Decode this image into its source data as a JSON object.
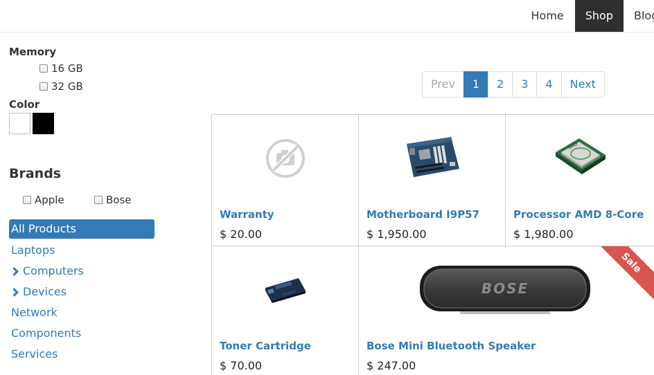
{
  "nav": {
    "items": [
      {
        "label": "Home",
        "active": false
      },
      {
        "label": "Shop",
        "active": true
      },
      {
        "label": "Blog",
        "active": false
      }
    ]
  },
  "filters": {
    "memory": {
      "title": "Memory",
      "options": [
        "16 GB",
        "32 GB"
      ]
    },
    "color": {
      "title": "Color",
      "swatches": [
        "#ffffff",
        "#000000"
      ]
    },
    "brands": {
      "title": "Brands",
      "options": [
        "Apple",
        "Bose"
      ]
    }
  },
  "categories": [
    {
      "label": "All Products",
      "active": true,
      "expandable": false
    },
    {
      "label": "Laptops",
      "active": false,
      "expandable": false
    },
    {
      "label": "Computers",
      "active": false,
      "expandable": true
    },
    {
      "label": "Devices",
      "active": false,
      "expandable": true
    },
    {
      "label": "Network",
      "active": false,
      "expandable": false
    },
    {
      "label": "Components",
      "active": false,
      "expandable": false
    },
    {
      "label": "Services",
      "active": false,
      "expandable": false
    }
  ],
  "pagination": {
    "prev": "Prev",
    "pages": [
      "1",
      "2",
      "3",
      "4"
    ],
    "current": "1",
    "next": "Next"
  },
  "products": [
    {
      "name": "Warranty",
      "price": "$ 20.00",
      "image": "no-image-icon",
      "sale": false
    },
    {
      "name": "Motherboard I9P57",
      "price": "$ 1,950.00",
      "image": "motherboard-image",
      "sale": false
    },
    {
      "name": "Processor AMD 8-Core",
      "price": "$ 1,980.00",
      "image": "processor-image",
      "sale": false
    },
    {
      "name": "Toner Cartridge",
      "price": "$ 70.00",
      "image": "toner-image",
      "sale": false
    },
    {
      "name": "Bose Mini Bluetooth Speaker",
      "price": "$ 247.00",
      "image": "speaker-image",
      "sale": true,
      "sale_label": "Sale",
      "logo_text": "BOSE"
    }
  ],
  "colors": {
    "accent": "#337ab7",
    "nav_active": "#2f2f2f",
    "sale": "#d9534f"
  }
}
